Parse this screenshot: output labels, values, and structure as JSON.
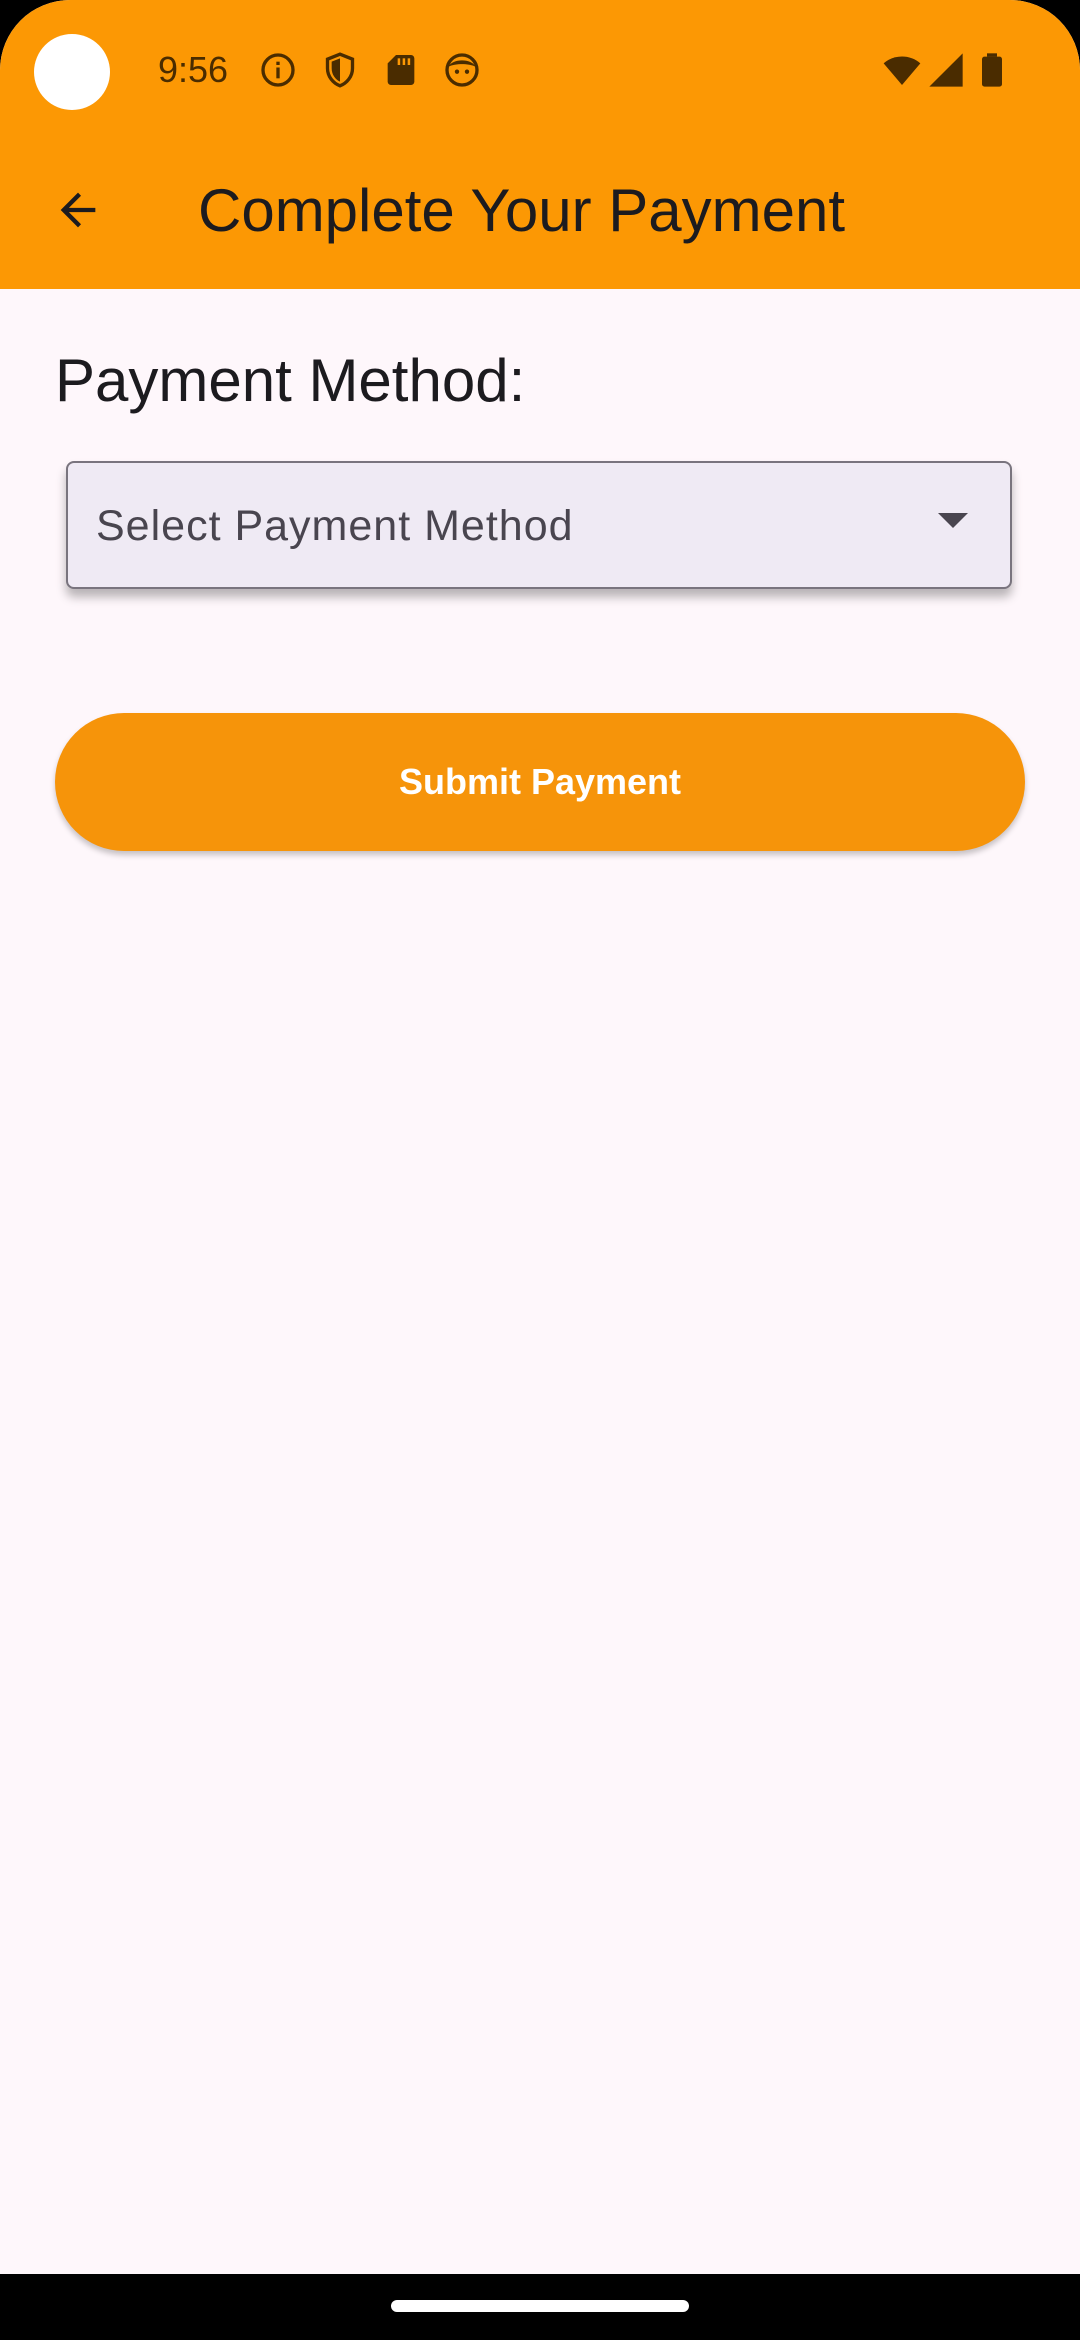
{
  "status_bar": {
    "time": "9:56",
    "left_icons": [
      "info-icon",
      "shield-icon",
      "sd-card-icon",
      "face-icon"
    ],
    "right_icons": [
      "wifi-icon",
      "signal-icon",
      "battery-icon"
    ]
  },
  "app_bar": {
    "title": "Complete Your Payment",
    "back_icon": "arrow-back-icon",
    "color": "#fc9804"
  },
  "form": {
    "payment_method_label": "Payment Method:",
    "dropdown": {
      "placeholder": "Select Payment Method",
      "icon": "dropdown-arrow-icon"
    },
    "submit_label": "Submit Payment"
  },
  "colors": {
    "accent": "#fc9804",
    "button": "#f6940a",
    "background": "#fef7fb"
  }
}
